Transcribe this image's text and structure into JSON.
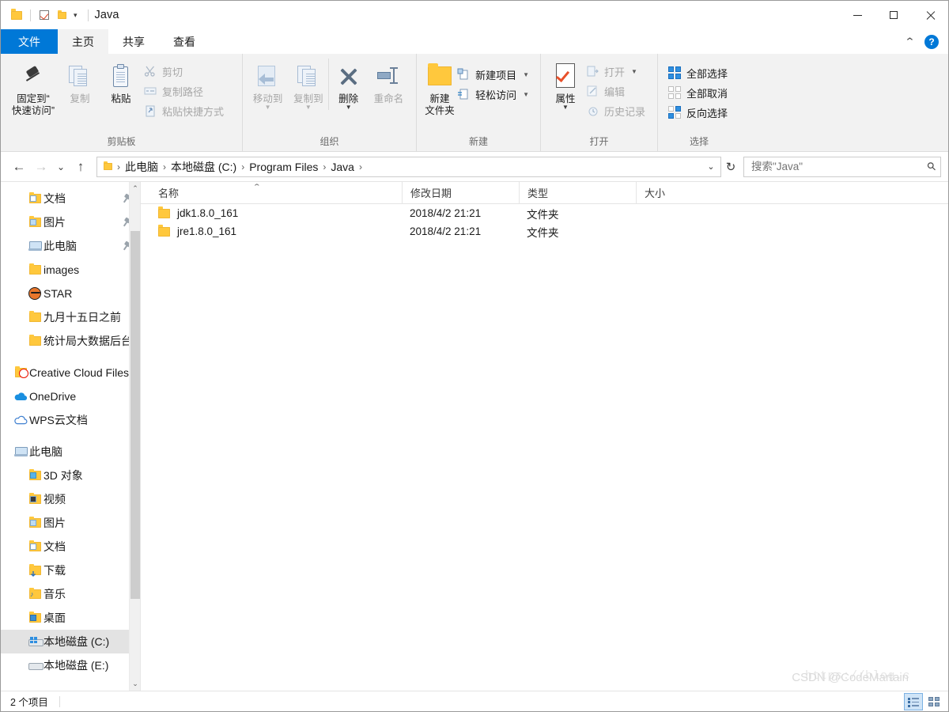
{
  "window": {
    "title": "Java",
    "controls": {
      "minimize": "minimize",
      "maximize": "maximize",
      "close": "close"
    }
  },
  "quick_access": {
    "folder_icon": "folder-icon",
    "checkbox_icon": "checkbox-icon",
    "folder_icon_2": "folder-icon",
    "dropdown_caret": "▾"
  },
  "tabs": [
    {
      "label": "文件",
      "kind": "file"
    },
    {
      "label": "主页",
      "kind": "active"
    },
    {
      "label": "共享",
      "kind": "normal"
    },
    {
      "label": "查看",
      "kind": "normal"
    }
  ],
  "ribbon": {
    "collapse_icon": "chevron-up-icon",
    "help_label": "?",
    "groups": [
      {
        "name": "剪贴板",
        "big_buttons": [
          {
            "label_line1": "固定到“",
            "label_line2": "快速访问”",
            "icon": "pin-icon",
            "dim": false
          },
          {
            "label_line1": "复制",
            "label_line2": "",
            "icon": "copy-icon",
            "dim": true
          },
          {
            "label_line1": "粘贴",
            "label_line2": "",
            "icon": "paste-icon",
            "dim": false
          }
        ],
        "small_buttons": [
          {
            "label": "剪切",
            "icon": "scissors-icon",
            "dim": true
          },
          {
            "label": "复制路径",
            "icon": "copy-path-icon",
            "dim": true
          },
          {
            "label": "粘贴快捷方式",
            "icon": "paste-shortcut-icon",
            "dim": true
          }
        ]
      },
      {
        "name": "组织",
        "big_buttons": [
          {
            "label_line1": "移动到",
            "label_line2": "",
            "icon": "move-to-icon",
            "dim": true,
            "caret": true
          },
          {
            "label_line1": "复制到",
            "label_line2": "",
            "icon": "copy-to-icon",
            "dim": true,
            "caret": true
          },
          {
            "label_line1": "删除",
            "label_line2": "",
            "icon": "delete-icon",
            "dim": false,
            "caret": true
          },
          {
            "label_line1": "重命名",
            "label_line2": "",
            "icon": "rename-icon",
            "dim": true
          }
        ],
        "small_buttons": []
      },
      {
        "name": "新建",
        "big_buttons": [
          {
            "label_line1": "新建",
            "label_line2": "文件夹",
            "icon": "new-folder-icon",
            "dim": false
          }
        ],
        "small_buttons": [
          {
            "label": "新建项目",
            "icon": "new-item-icon",
            "dim": false,
            "caret": true
          },
          {
            "label": "轻松访问",
            "icon": "easy-access-icon",
            "dim": false,
            "caret": true
          }
        ]
      },
      {
        "name": "打开",
        "big_buttons": [
          {
            "label_line1": "属性",
            "label_line2": "",
            "icon": "properties-icon",
            "dim": false,
            "caret": true
          }
        ],
        "small_buttons": [
          {
            "label": "打开",
            "icon": "open-icon",
            "dim": true,
            "caret": true
          },
          {
            "label": "编辑",
            "icon": "edit-icon",
            "dim": true
          },
          {
            "label": "历史记录",
            "icon": "history-icon",
            "dim": true
          }
        ]
      },
      {
        "name": "选择",
        "big_buttons": [],
        "small_buttons": [
          {
            "label": "全部选择",
            "icon": "select-all-icon",
            "dim": false
          },
          {
            "label": "全部取消",
            "icon": "select-none-icon",
            "dim": false
          },
          {
            "label": "反向选择",
            "icon": "invert-selection-icon",
            "dim": false
          }
        ]
      }
    ]
  },
  "navigation": {
    "back_icon": "←",
    "forward_icon": "→",
    "recent_caret": "⌄",
    "up_icon": "↑",
    "breadcrumb_folder_icon": "folder-icon",
    "breadcrumbs": [
      "此电脑",
      "本地磁盘 (C:)",
      "Program Files",
      "Java"
    ],
    "separator": "›",
    "dropdown_caret": "⌄",
    "refresh_icon": "↻"
  },
  "search": {
    "placeholder": "搜索\"Java\"",
    "value": "",
    "icon": "search-icon"
  },
  "sidebar": {
    "items": [
      {
        "label": "文档",
        "icon": "folder-doc-icon",
        "indent": 1,
        "pinned": true,
        "selected": false
      },
      {
        "label": "图片",
        "icon": "folder-pic-icon",
        "indent": 1,
        "pinned": true,
        "selected": false
      },
      {
        "label": "此电脑",
        "icon": "computer-icon",
        "indent": 1,
        "pinned": true,
        "selected": false
      },
      {
        "label": "images",
        "icon": "folder-icon",
        "indent": 1,
        "pinned": false,
        "selected": false
      },
      {
        "label": "STAR",
        "icon": "star-app-icon",
        "indent": 1,
        "pinned": false,
        "selected": false
      },
      {
        "label": "九月十五日之前",
        "icon": "folder-icon",
        "indent": 1,
        "pinned": false,
        "selected": false
      },
      {
        "label": "统计局大数据后台",
        "icon": "folder-icon",
        "indent": 1,
        "pinned": false,
        "selected": false
      },
      {
        "label": "Creative Cloud Files",
        "icon": "creative-cloud-icon",
        "indent": 0,
        "pinned": false,
        "selected": false,
        "gap_before": true
      },
      {
        "label": "OneDrive",
        "icon": "onedrive-icon",
        "indent": 0,
        "pinned": false,
        "selected": false
      },
      {
        "label": "WPS云文档",
        "icon": "wps-cloud-icon",
        "indent": 0,
        "pinned": false,
        "selected": false
      },
      {
        "label": "此电脑",
        "icon": "computer-icon",
        "indent": 0,
        "pinned": false,
        "selected": false,
        "gap_before": true
      },
      {
        "label": "3D 对象",
        "icon": "folder-3d-icon",
        "indent": 1,
        "pinned": false,
        "selected": false
      },
      {
        "label": "视频",
        "icon": "folder-video-icon",
        "indent": 1,
        "pinned": false,
        "selected": false
      },
      {
        "label": "图片",
        "icon": "folder-pic-icon",
        "indent": 1,
        "pinned": false,
        "selected": false
      },
      {
        "label": "文档",
        "icon": "folder-doc-icon",
        "indent": 1,
        "pinned": false,
        "selected": false
      },
      {
        "label": "下载",
        "icon": "folder-download-icon",
        "indent": 1,
        "pinned": false,
        "selected": false
      },
      {
        "label": "音乐",
        "icon": "folder-music-icon",
        "indent": 1,
        "pinned": false,
        "selected": false
      },
      {
        "label": "桌面",
        "icon": "folder-desktop-icon",
        "indent": 1,
        "pinned": false,
        "selected": false
      },
      {
        "label": "本地磁盘 (C:)",
        "icon": "drive-windows-icon",
        "indent": 1,
        "pinned": false,
        "selected": true
      },
      {
        "label": "本地磁盘 (E:)",
        "icon": "drive-icon",
        "indent": 1,
        "pinned": false,
        "selected": false
      }
    ],
    "scroll_up_icon": "⌃",
    "scroll_down_icon": "⌄"
  },
  "filelist": {
    "columns": [
      {
        "label": "名称",
        "key": "name",
        "sorted": "asc"
      },
      {
        "label": "修改日期",
        "key": "date"
      },
      {
        "label": "类型",
        "key": "type"
      },
      {
        "label": "大小",
        "key": "size"
      }
    ],
    "sort_indicator": "⌃",
    "rows": [
      {
        "icon": "folder-icon",
        "name": "jdk1.8.0_161",
        "date": "2018/4/2 21:21",
        "type": "文件夹",
        "size": ""
      },
      {
        "icon": "folder-icon",
        "name": "jre1.8.0_161",
        "date": "2018/4/2 21:21",
        "type": "文件夹",
        "size": ""
      }
    ]
  },
  "statusbar": {
    "item_count": "2 个项目",
    "view_details_icon": "details-view-icon",
    "view_icons_icon": "large-icons-view-icon"
  },
  "watermark": {
    "url": "https://blog.c",
    "tag": "CSDN @CodeMartain"
  },
  "colors": {
    "accent": "#0078d7",
    "file_tab": "#0078d7",
    "folder_yellow": "#ffc83d",
    "selection": "#e3e3e3",
    "ribbon_bg": "#f2f2f2"
  }
}
